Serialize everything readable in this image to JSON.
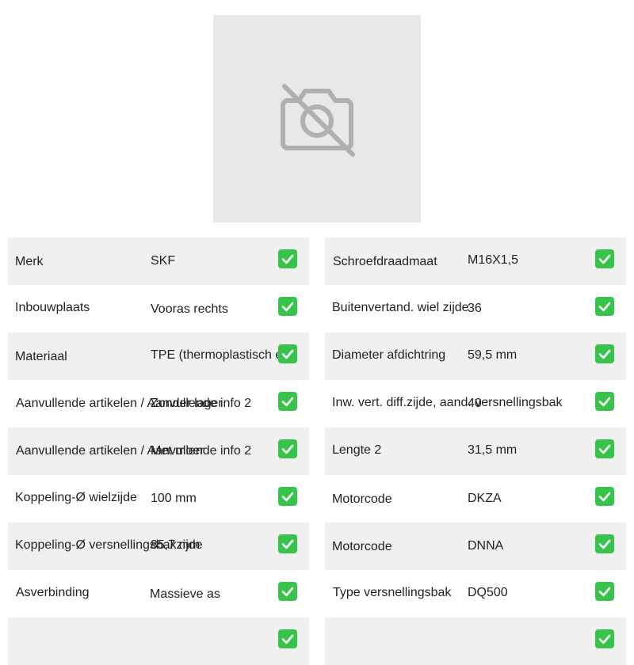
{
  "product_image": {
    "icon": "no-image-camera-icon"
  },
  "specs_left": [
    {
      "label": "Merk",
      "value": "SKF"
    },
    {
      "label": "Inbouwplaats",
      "value": "Vooras rechts"
    },
    {
      "label": "Materiaal",
      "value": "TPE (thermoplastisch ela"
    },
    {
      "label": "Aanvullende artikelen / Aanvullende info 2",
      "value": "Zonder lager"
    },
    {
      "label": "Aanvullende artikelen / Aanvullende info 2",
      "value": "Met moer"
    },
    {
      "label": "Koppeling-Ø wielzijde",
      "value": "100 mm"
    },
    {
      "label": "Koppeling-Ø versnellingsbakzijde",
      "value": "85,7 mm"
    },
    {
      "label": "Asverbinding",
      "value": "Massieve as"
    },
    {
      "label": "",
      "value": ""
    }
  ],
  "specs_right": [
    {
      "label": "Schroefdraadmaat",
      "value": "M16X1,5"
    },
    {
      "label": "Buitenvertand. wiel zijde",
      "value": "36"
    },
    {
      "label": "Diameter afdichtring",
      "value": "59,5 mm"
    },
    {
      "label": "Inw. vert. diff.zijde, aand. versnellingsbak",
      "value": "40"
    },
    {
      "label": "Lengte 2",
      "value": "31,5 mm"
    },
    {
      "label": "Motorcode",
      "value": "DKZA"
    },
    {
      "label": "Motorcode",
      "value": "DNNA"
    },
    {
      "label": "Type versnellingsbak",
      "value": "DQ500"
    },
    {
      "label": "",
      "value": ""
    }
  ],
  "colors": {
    "row_shaded": "#f0f0f0",
    "check": "#36c54a",
    "placeholder_bg": "#e8e8e8",
    "placeholder_icon": "#b0b0b0"
  }
}
